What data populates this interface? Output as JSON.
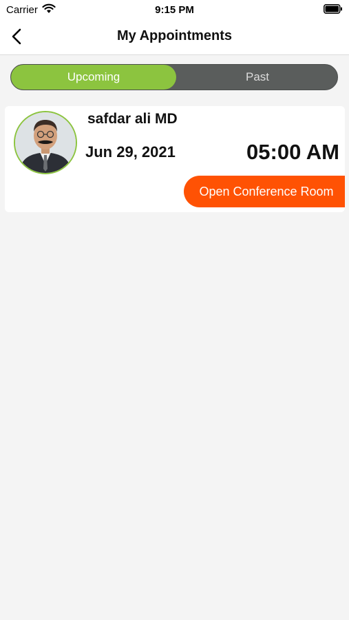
{
  "status_bar": {
    "carrier": "Carrier",
    "time": "9:15 PM"
  },
  "nav": {
    "title": "My Appointments"
  },
  "tabs": [
    {
      "label": "Upcoming",
      "selected": true
    },
    {
      "label": "Past",
      "selected": false
    }
  ],
  "appointments": [
    {
      "doctor_name": "safdar ali MD",
      "date": "Jun 29, 2021",
      "time": "05:00 AM",
      "action_label": "Open Conference Room"
    }
  ],
  "colors": {
    "accent_green": "#8cc43f",
    "action_orange": "#ff5204",
    "segment_dark": "#5a5d5c",
    "background": "#f4f4f4"
  }
}
